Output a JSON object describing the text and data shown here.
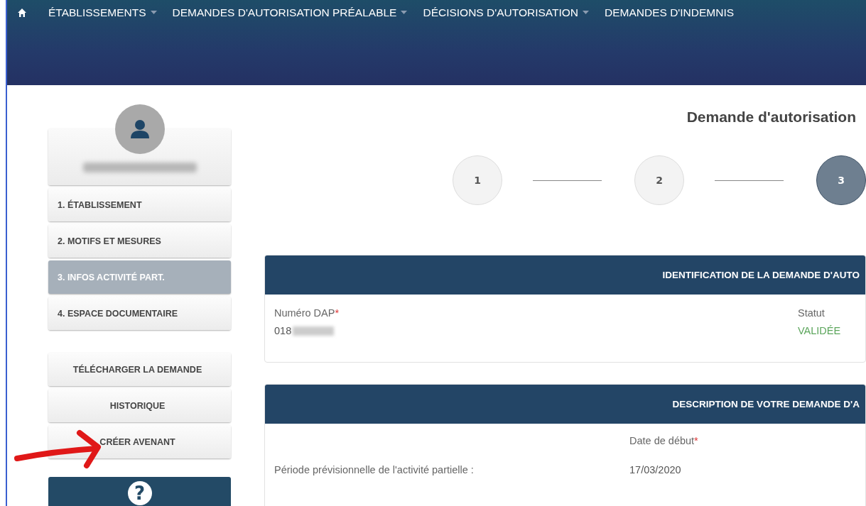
{
  "navbar": {
    "items": [
      {
        "label": "ÉTABLISSEMENTS",
        "caret": true
      },
      {
        "label": "DEMANDES D'AUTORISATION PRÉALABLE",
        "caret": true
      },
      {
        "label": "DÉCISIONS D'AUTORISATION",
        "caret": true
      },
      {
        "label": "DEMANDES D'INDEMNIS",
        "caret": false
      }
    ]
  },
  "sidebar": {
    "steps": [
      {
        "label": "1. ÉTABLISSEMENT",
        "selected": false
      },
      {
        "label": "2. MOTIFS ET MESURES",
        "selected": false
      },
      {
        "label": "3. INFOS ACTIVITÉ PART.",
        "selected": true
      },
      {
        "label": "4. ESPACE DOCUMENTAIRE",
        "selected": false
      }
    ],
    "actions": [
      "TÉLÉCHARGER LA DEMANDE",
      "HISTORIQUE",
      "CRÉER AVENANT"
    ],
    "help": {
      "icon": "?"
    }
  },
  "page_title": "Demande d'autorisation",
  "stepper": [
    {
      "label": "1",
      "selected": false
    },
    {
      "label": "2",
      "selected": false
    },
    {
      "label": "3",
      "selected": true
    }
  ],
  "panels": [
    {
      "title": "IDENTIFICATION DE LA DEMANDE D'AUTO",
      "kind": "identification",
      "fields": [
        {
          "label": "Numéro DAP",
          "required_mark": "*",
          "value": "018"
        },
        {
          "label": "Statut",
          "value": "VALIDÉE",
          "color": "#5da65d"
        }
      ]
    },
    {
      "title": "DESCRIPTION DE VOTRE DEMANDE D'A",
      "kind": "period",
      "row_label": "Période prévisionnelle de l'activité partielle :",
      "fields": [
        {
          "label": "Date de début",
          "required_mark": "*",
          "value": "17/03/2020"
        }
      ]
    }
  ],
  "annotation": {
    "kind": "arrow"
  }
}
